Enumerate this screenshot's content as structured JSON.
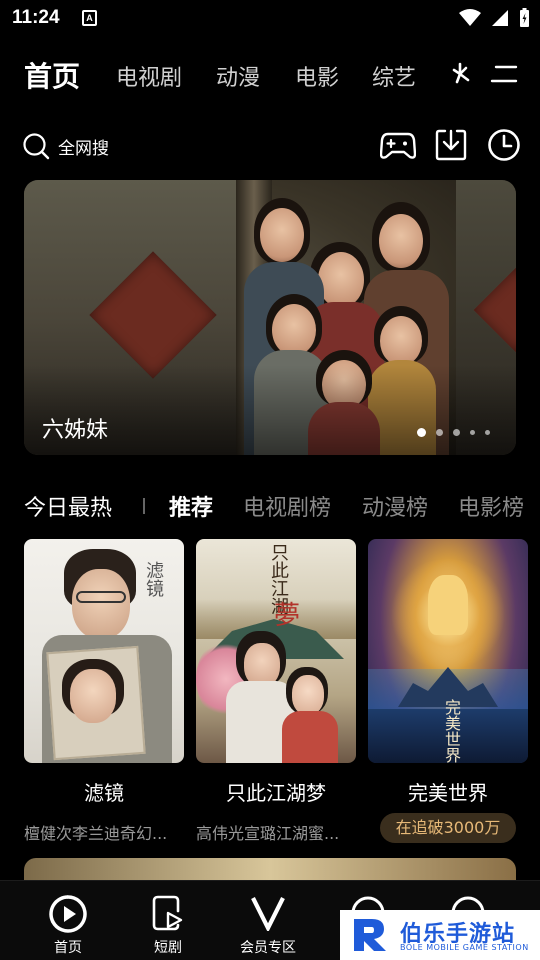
{
  "status_bar": {
    "time": "11:24",
    "notification_letter": "A",
    "icons": [
      "wifi-icon",
      "signal-icon",
      "battery-charging-icon"
    ]
  },
  "top_nav": {
    "tabs": [
      {
        "label": "首页",
        "active": true
      },
      {
        "label": "电视剧",
        "active": false
      },
      {
        "label": "动漫",
        "active": false
      },
      {
        "label": "电影",
        "active": false
      },
      {
        "label": "综艺",
        "active": false
      }
    ],
    "icons": [
      "sport-icon",
      "menu-icon"
    ]
  },
  "search": {
    "label": "全网搜",
    "tools": [
      "gamepad-icon",
      "download-icon",
      "history-clock-icon"
    ]
  },
  "banner": {
    "title": "六姊妹",
    "slide_count": 5,
    "active_slide": 1
  },
  "section": {
    "title": "今日最热",
    "tabs": [
      {
        "label": "推荐",
        "active": true
      },
      {
        "label": "电视剧榜",
        "active": false
      },
      {
        "label": "动漫榜",
        "active": false
      },
      {
        "label": "电影榜",
        "active": false
      }
    ]
  },
  "cards": [
    {
      "title": "滤镜",
      "subtitle": "檀健次李兰迪奇幻...",
      "badge": ""
    },
    {
      "title": "只此江湖梦",
      "subtitle": "高伟光宣璐江湖蜜...",
      "badge": ""
    },
    {
      "title": "完美世界",
      "subtitle": "",
      "badge": "在追破3000万"
    }
  ],
  "bottom_nav": [
    {
      "label": "首页",
      "icon": "home-play-icon",
      "active": true
    },
    {
      "label": "短剧",
      "icon": "short-video-icon",
      "active": false
    },
    {
      "label": "会员专区",
      "icon": "vip-v-icon",
      "active": false
    },
    {
      "label": "",
      "icon": "message-icon",
      "active": false
    },
    {
      "label": "",
      "icon": "profile-icon",
      "active": false
    }
  ],
  "watermark": {
    "name": "伯乐手游站",
    "sub": "BOLE MOBILE GAME STATION"
  },
  "colors": {
    "background": "#000000",
    "badge_text": "#e7b978",
    "watermark_blue": "#1f5bd9"
  }
}
